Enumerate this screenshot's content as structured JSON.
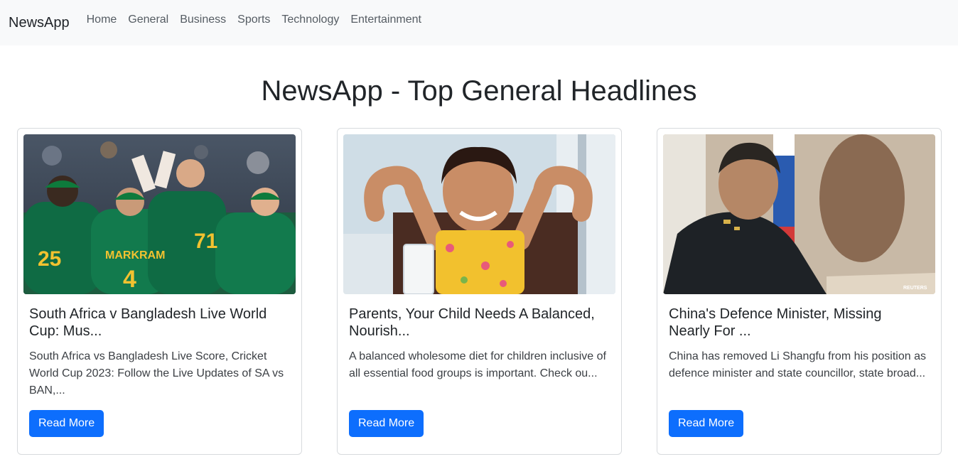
{
  "nav": {
    "brand": "NewsApp",
    "links": [
      "Home",
      "General",
      "Business",
      "Sports",
      "Technology",
      "Entertainment"
    ]
  },
  "page": {
    "title": "NewsApp - Top General Headlines"
  },
  "articles": [
    {
      "title": "South Africa v Bangladesh Live World Cup: Mus...",
      "description": "South Africa vs Bangladesh Live Score, Cricket World Cup 2023: Follow the Live Updates of SA vs BAN,...",
      "button": "Read More",
      "image": "cricket-team-celebration-photo"
    },
    {
      "title": "Parents, Your Child Needs A Balanced, Nourish...",
      "description": "A balanced wholesome diet for children inclusive of all essential food groups is important. Check ou...",
      "button": "Read More",
      "image": "child-flexing-with-milk-photo"
    },
    {
      "title": "China's Defence Minister, Missing Nearly For ...",
      "description": "China has removed Li Shangfu from his position as defence minister and state councillor, state broad...",
      "button": "Read More",
      "image": "defence-minister-portrait-photo",
      "image_credit": "REUTERS"
    }
  ],
  "colors": {
    "accent": "#0d6efd",
    "navbar_bg": "#f8f9fa"
  }
}
